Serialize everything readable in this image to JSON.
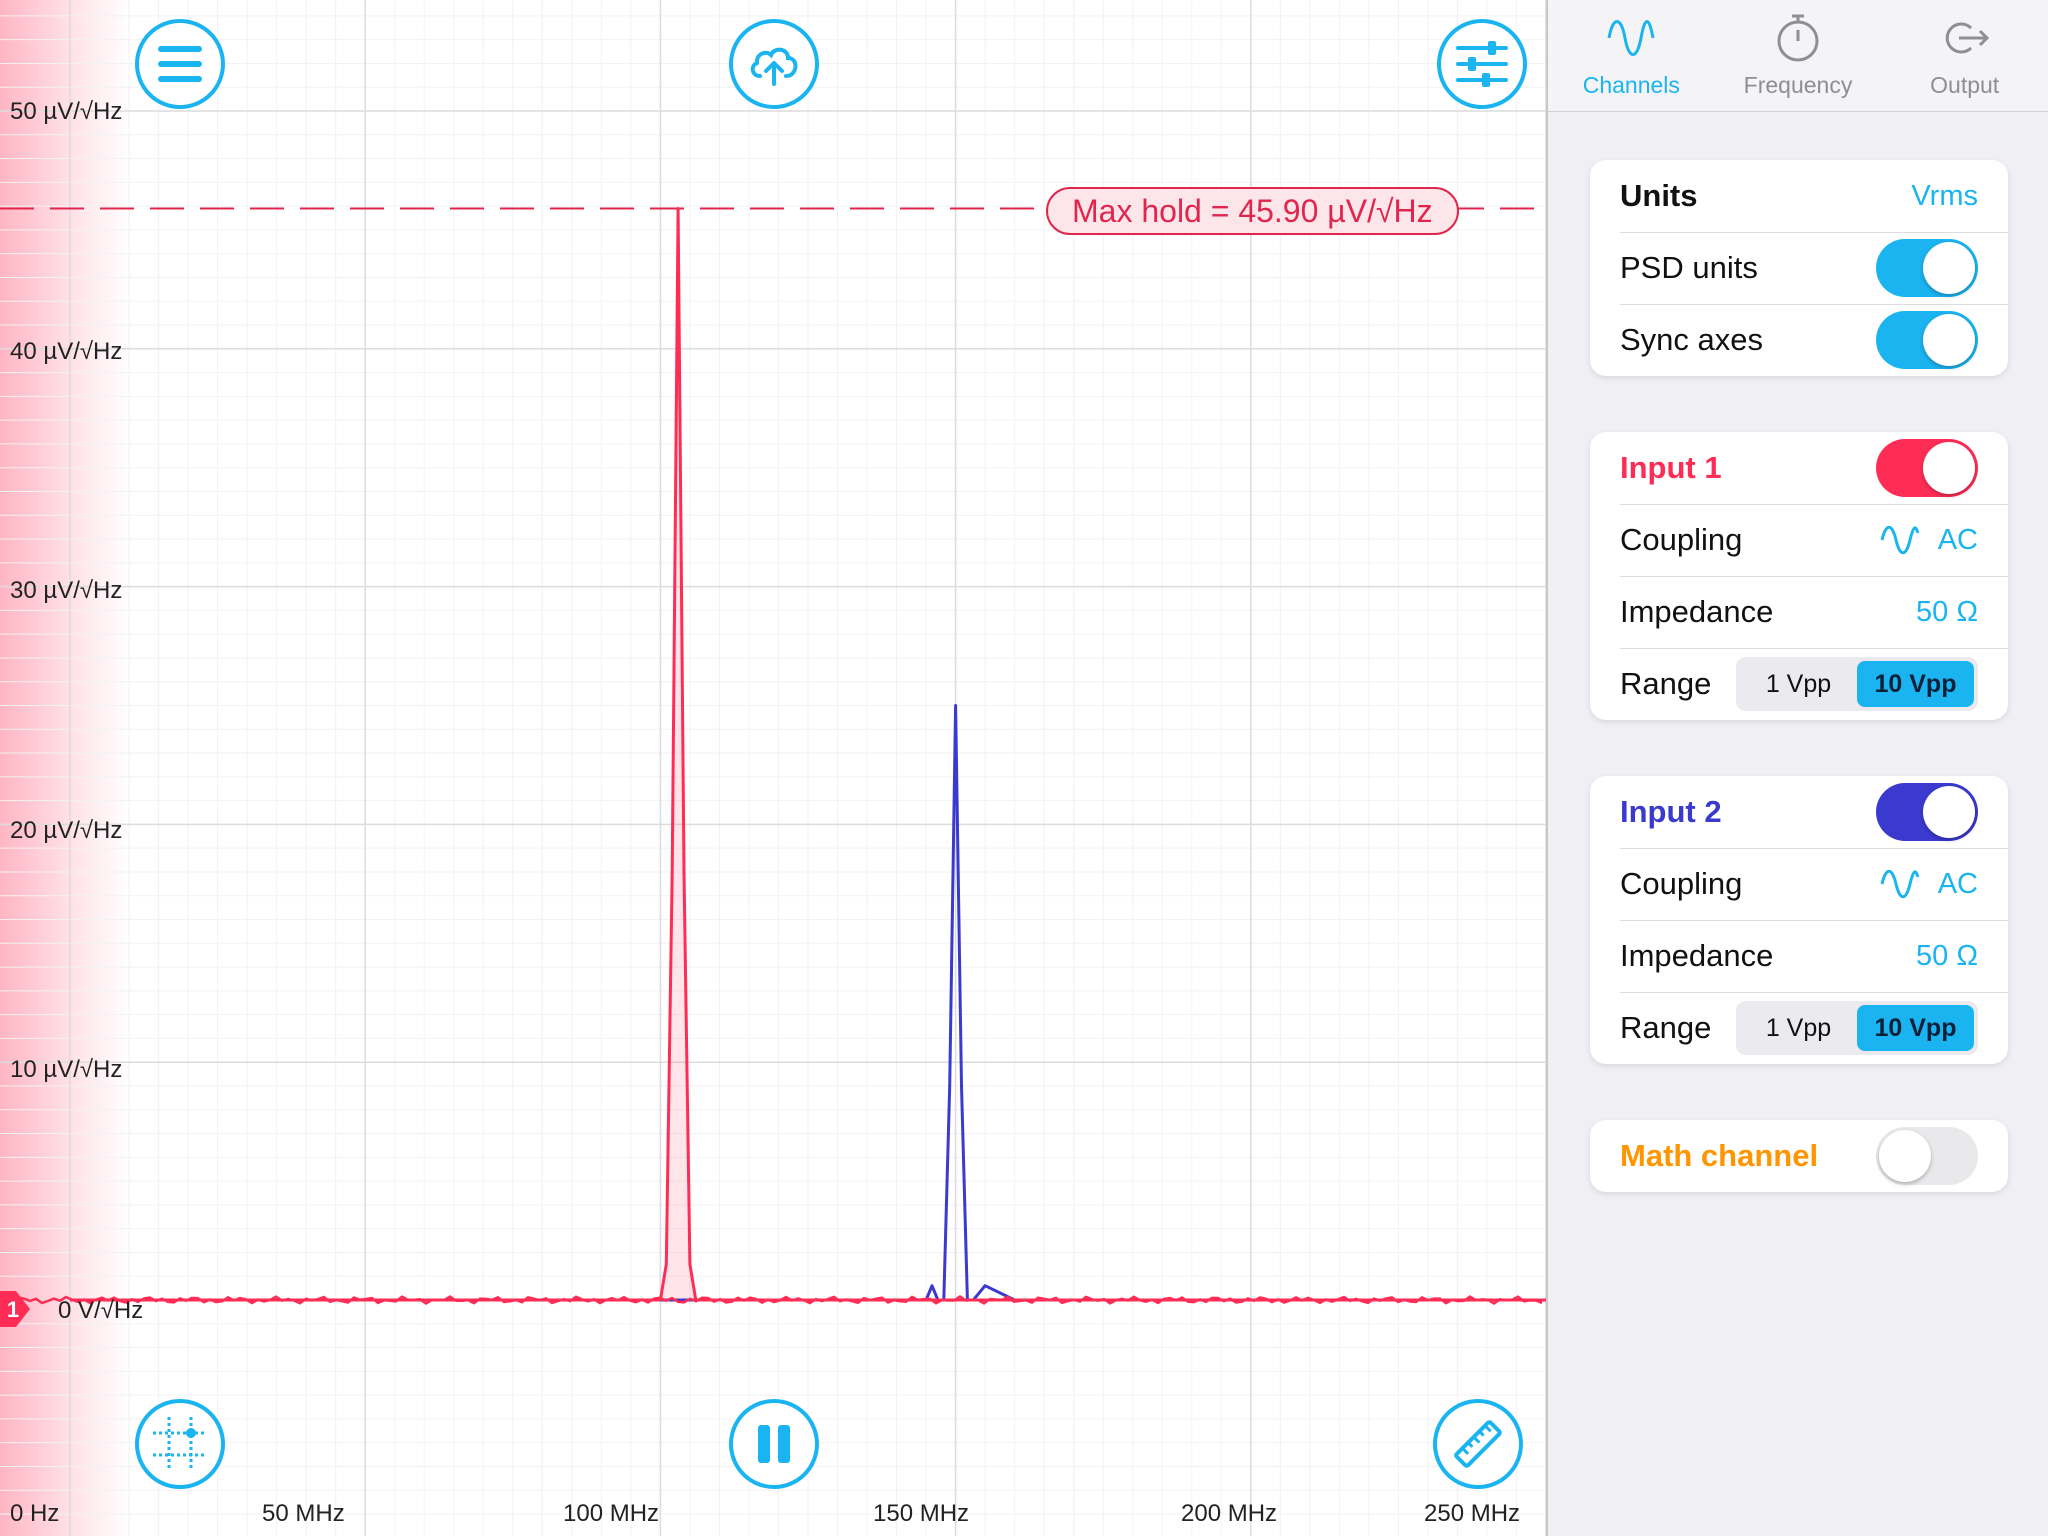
{
  "colors": {
    "accent": "#1ab4f0",
    "input1": "#ff2d55",
    "input2": "#3a3acf",
    "math": "#ff9500",
    "maxhold": "#e0264d"
  },
  "toolbar": {
    "menu_icon": "menu-icon",
    "upload_icon": "cloud-upload-icon",
    "settings_icon": "sliders-icon",
    "grid_icon": "grid-cursor-icon",
    "pause_icon": "pause-icon",
    "measure_icon": "ruler-icon"
  },
  "plot": {
    "max_hold_label": "Max hold = 45.90 µV/√Hz",
    "zero_label": "0 V/√Hz",
    "channel_marker": "1",
    "y_ticks": [
      "50 µV/√Hz",
      "40 µV/√Hz",
      "30 µV/√Hz",
      "20 µV/√Hz",
      "10 µV/√Hz"
    ],
    "x_ticks": [
      "0 Hz",
      "50 MHz",
      "100 MHz",
      "150 MHz",
      "200 MHz",
      "250 MHz"
    ]
  },
  "chart_data": {
    "type": "line",
    "xlabel": "",
    "ylabel": "",
    "xlim": [
      0,
      250
    ],
    "ylim": [
      0,
      50
    ],
    "x_unit": "MHz",
    "y_unit": "µV/√Hz",
    "max_hold": 45.9,
    "series": [
      {
        "x": [
          0,
          100,
          101,
          102,
          103,
          104,
          105,
          106,
          107,
          250
        ],
        "y": [
          0,
          0,
          1.5,
          18,
          45.9,
          18,
          1.5,
          0,
          0,
          0
        ]
      },
      {
        "x": [
          0,
          140,
          145,
          146,
          147,
          148,
          149,
          150,
          151,
          152,
          153,
          155,
          160,
          250
        ],
        "y": [
          0,
          0,
          0,
          0.6,
          0,
          0,
          9,
          25,
          9,
          0,
          0,
          0.6,
          0,
          0
        ]
      }
    ]
  },
  "tabs": [
    {
      "label": "Channels",
      "icon": "sine-wave-icon",
      "active": true
    },
    {
      "label": "Frequency",
      "icon": "stopwatch-icon",
      "active": false
    },
    {
      "label": "Output",
      "icon": "output-arrow-icon",
      "active": false
    }
  ],
  "units_card": {
    "title": "Units",
    "value": "Vrms",
    "psd_label": "PSD units",
    "psd_on": true,
    "sync_label": "Sync axes",
    "sync_on": true
  },
  "input1": {
    "title": "Input 1",
    "enabled": true,
    "coupling_label": "Coupling",
    "coupling_value": "AC",
    "impedance_label": "Impedance",
    "impedance_value": "50 Ω",
    "range_label": "Range",
    "range_options": [
      "1 Vpp",
      "10 Vpp"
    ],
    "range_selected": "10 Vpp"
  },
  "input2": {
    "title": "Input 2",
    "enabled": true,
    "coupling_label": "Coupling",
    "coupling_value": "AC",
    "impedance_label": "Impedance",
    "impedance_value": "50 Ω",
    "range_label": "Range",
    "range_options": [
      "1 Vpp",
      "10 Vpp"
    ],
    "range_selected": "10 Vpp"
  },
  "math_card": {
    "title": "Math channel",
    "enabled": false
  }
}
